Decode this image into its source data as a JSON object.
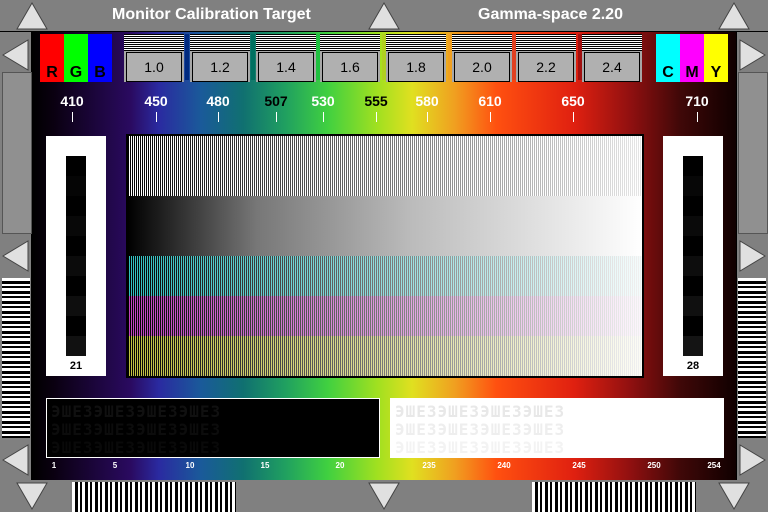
{
  "header": {
    "title": "Monitor Calibration Target",
    "gamma_label": "Gamma-space 2.20"
  },
  "color_swatches_left": [
    {
      "label": "R",
      "color": "#ff0000"
    },
    {
      "label": "G",
      "color": "#00ff00"
    },
    {
      "label": "B",
      "color": "#0000ff"
    }
  ],
  "color_swatches_right": [
    {
      "label": "C",
      "color": "#00ffff"
    },
    {
      "label": "M",
      "color": "#ff00ff"
    },
    {
      "label": "Y",
      "color": "#ffff00"
    }
  ],
  "gamma_boxes": [
    {
      "label": "1.0",
      "tick_color": ""
    },
    {
      "label": "1.2",
      "tick_color": "#002a80"
    },
    {
      "label": "1.4",
      "tick_color": "#007060"
    },
    {
      "label": "1.6",
      "tick_color": "#20c040"
    },
    {
      "label": "1.8",
      "tick_color": "#b0d020"
    },
    {
      "label": "2.0",
      "tick_color": "#f0a020"
    },
    {
      "label": "2.2",
      "tick_color": "#e04020"
    },
    {
      "label": "2.4",
      "tick_color": "#a01010"
    }
  ],
  "wavelengths": [
    {
      "label": "410",
      "color": "#ffffff"
    },
    {
      "label": "450",
      "color": "#ffffff"
    },
    {
      "label": "480",
      "color": "#ffffff"
    },
    {
      "label": "507",
      "color": "#000000"
    },
    {
      "label": "530",
      "color": "#ffffff"
    },
    {
      "label": "555",
      "color": "#000000"
    },
    {
      "label": "580",
      "color": "#ffffff"
    },
    {
      "label": "610",
      "color": "#ffffff"
    },
    {
      "label": "650",
      "color": "#ffffff"
    },
    {
      "label": "710",
      "color": "#ffffff"
    }
  ],
  "side_panels": {
    "left_label": "21",
    "right_label": "28"
  },
  "dark_scale_labels": [
    "1",
    "5",
    "10",
    "15",
    "20"
  ],
  "light_scale_labels": [
    "235",
    "240",
    "245",
    "250",
    "254"
  ],
  "glyph": "ЭШЕЗ"
}
